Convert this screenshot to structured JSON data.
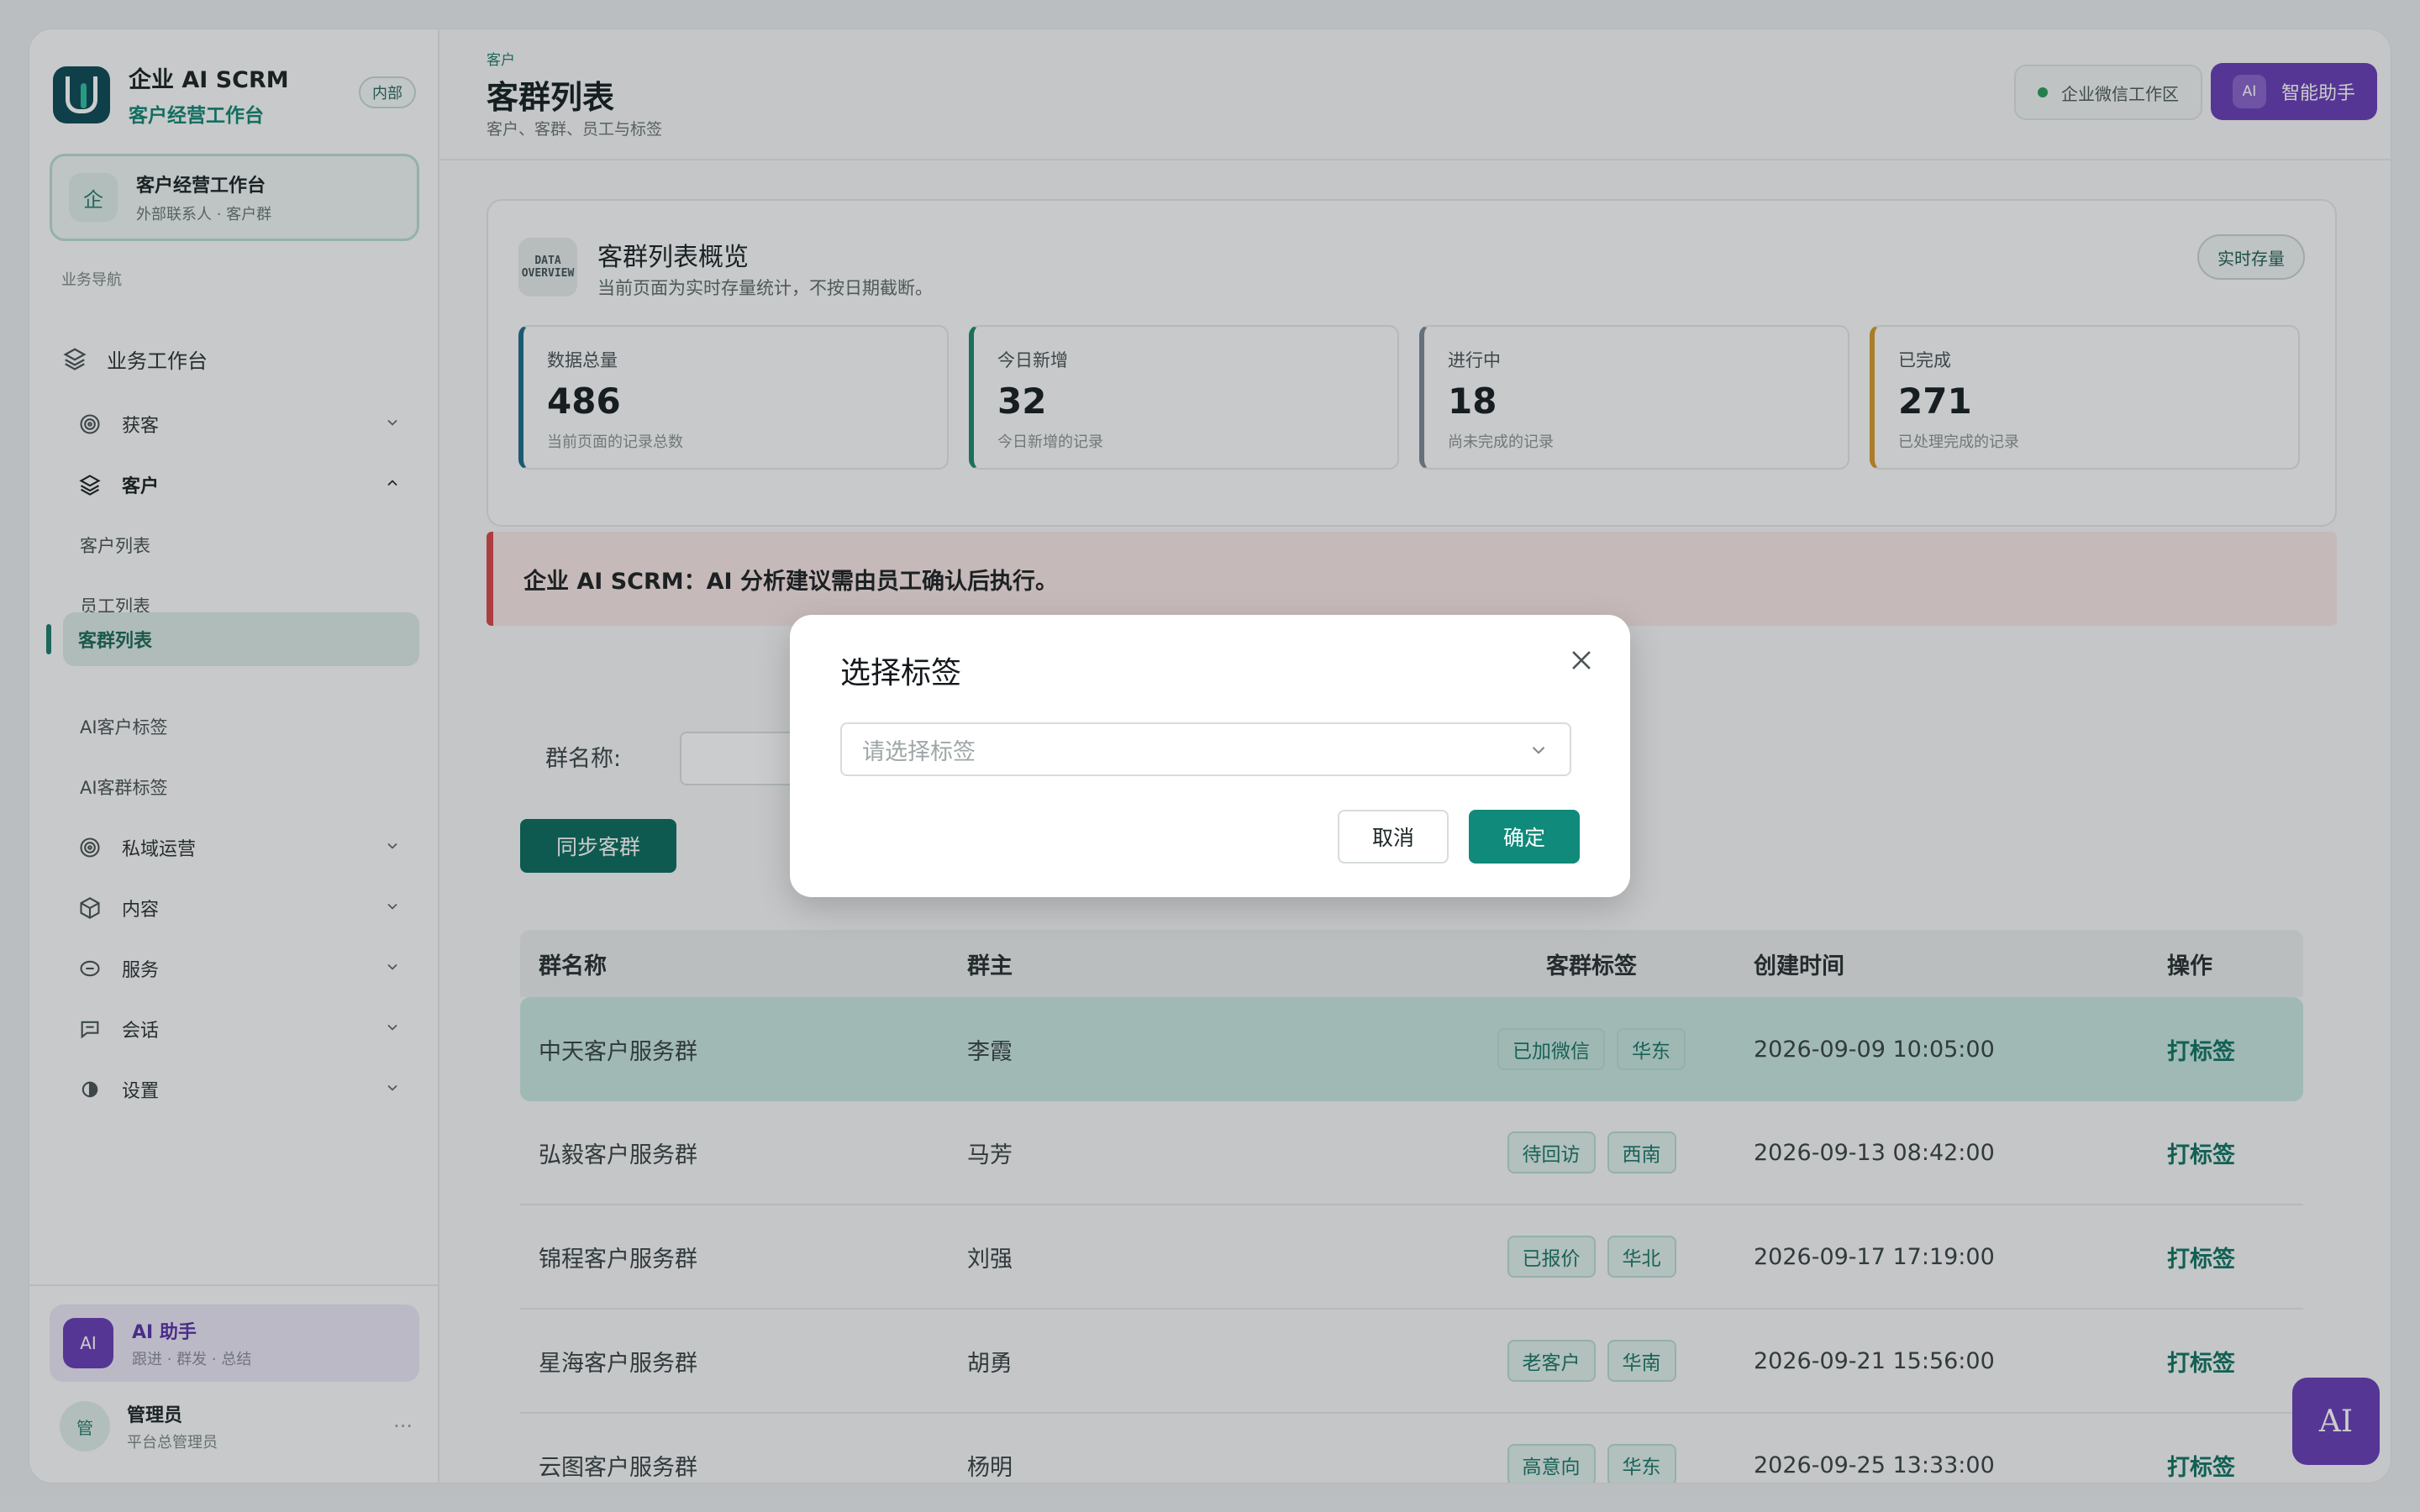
{
  "app": {
    "title": "企业 AI SCRM",
    "subtitle": "客户经营工作台",
    "badge": "内部"
  },
  "workspace_card": {
    "icon_char": "企",
    "title": "客户经营工作台",
    "subtitle": "外部联系人 · 客户群"
  },
  "sidebar": {
    "section_label": "业务导航",
    "top_item": "业务工作台",
    "items": [
      {
        "label": "获客",
        "icon": "target-icon"
      },
      {
        "label": "客户",
        "icon": "layers-icon"
      },
      {
        "label": "客户列表"
      },
      {
        "label": "员工列表"
      },
      {
        "label": "客群列表"
      },
      {
        "label": "AI客户标签"
      },
      {
        "label": "AI客群标签"
      },
      {
        "label": "私域运营",
        "icon": "target-icon"
      },
      {
        "label": "内容",
        "icon": "cube-icon"
      },
      {
        "label": "服务",
        "icon": "service-icon"
      },
      {
        "label": "会话",
        "icon": "chat-icon"
      },
      {
        "label": "设置",
        "icon": "gear-icon"
      }
    ]
  },
  "ai_assistant_card": {
    "avatar": "AI",
    "title": "AI 助手",
    "subtitle": "跟进 · 群发 · 总结"
  },
  "user": {
    "avatar": "管",
    "name": "管理员",
    "role": "平台总管理员",
    "more": "···"
  },
  "header": {
    "breadcrumb": "客户",
    "title": "客群列表",
    "subtitle": "客户、客群、员工与标签",
    "env_label": "企业微信工作区",
    "assistant_chip": "AI",
    "assistant_label": "智能助手"
  },
  "overview": {
    "icon_text": "DATA OVERVIEW",
    "title": "客群列表概览",
    "subtitle": "当前页面为实时存量统计，不按日期截断。",
    "pill": "实时存量",
    "stats": [
      {
        "label": "数据总量",
        "value": "486",
        "sub": "当前页面的记录总数",
        "color": "#1f6e8c"
      },
      {
        "label": "今日新增",
        "value": "32",
        "sub": "今日新增的记录",
        "color": "#1f8a6e"
      },
      {
        "label": "进行中",
        "value": "18",
        "sub": "尚未完成的记录",
        "color": "#7d8a95"
      },
      {
        "label": "已完成",
        "value": "271",
        "sub": "已处理完成的记录",
        "color": "#d79a2b"
      }
    ]
  },
  "notice": "企业 AI SCRM：AI 分析建议需由员工确认后执行。",
  "filter": {
    "label": "群名称:",
    "value": ""
  },
  "sync_button": "同步客群",
  "table": {
    "columns": [
      "群名称",
      "群主",
      "客群标签",
      "创建时间",
      "操作"
    ],
    "rows": [
      {
        "name": "中天客户服务群",
        "owner": "李霞",
        "tags": [
          "已加微信",
          "华东"
        ],
        "time": "2026-09-09 10:05:00",
        "action": "打标签"
      },
      {
        "name": "弘毅客户服务群",
        "owner": "马芳",
        "tags": [
          "待回访",
          "西南"
        ],
        "time": "2026-09-13 08:42:00",
        "action": "打标签"
      },
      {
        "name": "锦程客户服务群",
        "owner": "刘强",
        "tags": [
          "已报价",
          "华北"
        ],
        "time": "2026-09-17 17:19:00",
        "action": "打标签"
      },
      {
        "name": "星海客户服务群",
        "owner": "胡勇",
        "tags": [
          "老客户",
          "华南"
        ],
        "time": "2026-09-21 15:56:00",
        "action": "打标签"
      },
      {
        "name": "云图客户服务群",
        "owner": "杨明",
        "tags": [
          "高意向",
          "华东"
        ],
        "time": "2026-09-25 13:33:00",
        "action": "打标签"
      }
    ]
  },
  "fab_label": "AI",
  "modal": {
    "title": "选择标签",
    "select_placeholder": "请选择标签",
    "cancel": "取消",
    "confirm": "确定"
  }
}
